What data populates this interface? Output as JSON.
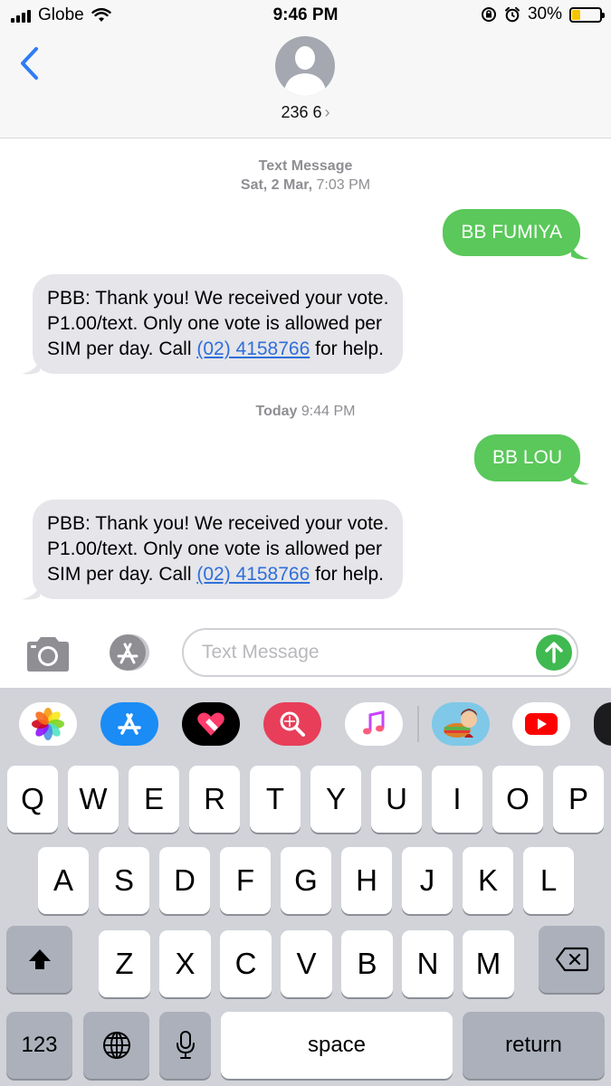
{
  "status_bar": {
    "carrier": "Globe",
    "time": "9:46 PM",
    "battery_percent": "30%",
    "battery_level": 0.3
  },
  "header": {
    "contact_name": "236 6",
    "chevron": "›"
  },
  "conversation": {
    "timestamp1": {
      "label": "Text Message",
      "day": "Sat, 2 Mar,",
      "time": "7:03 PM"
    },
    "messages": [
      {
        "direction": "outgoing",
        "text": "BB FUMIYA"
      },
      {
        "direction": "incoming",
        "line1": "PBB: Thank you! We received your vote.",
        "line2": "P1.00/text. Only one vote is allowed per",
        "line3_pre": "SIM per day. Call ",
        "link": "(02) 4158766",
        "line3_post": " for help."
      },
      {
        "direction": "outgoing",
        "text": "BB LOU"
      },
      {
        "direction": "incoming",
        "line1": "PBB: Thank you! We received your vote.",
        "line2": "P1.00/text. Only one vote is allowed per",
        "line3_pre": "SIM per day. Call ",
        "link": "(02) 4158766",
        "line3_post": " for help."
      }
    ],
    "timestamp2": {
      "day": "Today",
      "time": "9:44 PM"
    }
  },
  "input_bar": {
    "placeholder": "Text Message"
  },
  "app_strip": {
    "icons": [
      "photos-icon",
      "appstore-icon",
      "digital-touch-icon",
      "web-search-icon",
      "music-icon",
      "game-icon",
      "youtube-icon",
      "more-app-icon"
    ]
  },
  "keyboard": {
    "row1": [
      "Q",
      "W",
      "E",
      "R",
      "T",
      "Y",
      "U",
      "I",
      "O",
      "P"
    ],
    "row2": [
      "A",
      "S",
      "D",
      "F",
      "G",
      "H",
      "J",
      "K",
      "L"
    ],
    "row3": [
      "Z",
      "X",
      "C",
      "V",
      "B",
      "N",
      "M"
    ],
    "numbers_label": "123",
    "space_label": "space",
    "return_label": "return"
  },
  "colors": {
    "outgoing_bubble": "#5ac85a",
    "incoming_bubble": "#e5e5ea",
    "link": "#2e6fd9",
    "ios_blue": "#2f7cf6"
  }
}
